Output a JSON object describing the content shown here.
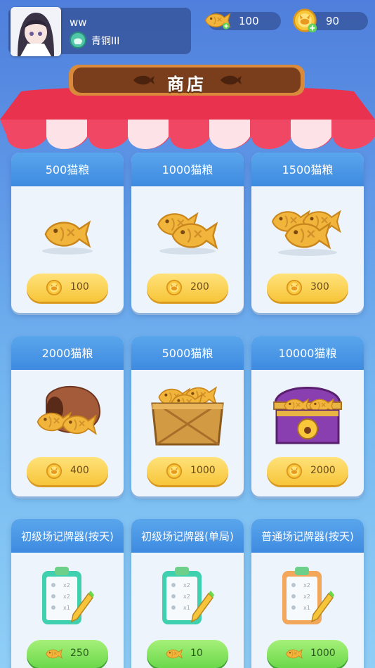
{
  "profile": {
    "name": "ww",
    "rank": "青铜III"
  },
  "currencies": [
    {
      "icon": "fish-food-icon",
      "value": "100"
    },
    {
      "icon": "cat-coin-icon",
      "value": "90"
    }
  ],
  "shop": {
    "title": "商店"
  },
  "items": [
    {
      "title": "500猫粮",
      "price": "100",
      "currency": "cat-coin-icon",
      "image": "single-fish-icon"
    },
    {
      "title": "1000猫粮",
      "price": "200",
      "currency": "cat-coin-icon",
      "image": "two-fish-icon"
    },
    {
      "title": "1500猫粮",
      "price": "300",
      "currency": "cat-coin-icon",
      "image": "three-fish-icon"
    },
    {
      "title": "2000猫粮",
      "price": "400",
      "currency": "cat-coin-icon",
      "image": "fish-bag-icon"
    },
    {
      "title": "5000猫粮",
      "price": "1000",
      "currency": "cat-coin-icon",
      "image": "fish-crate-icon"
    },
    {
      "title": "10000猫粮",
      "price": "2000",
      "currency": "cat-coin-icon",
      "image": "treasure-chest-icon"
    },
    {
      "title": "初级场记牌器(按天)",
      "price": "250",
      "currency": "fish-food-icon",
      "image": "green-clipboard-icon"
    },
    {
      "title": "初级场记牌器(单局)",
      "price": "10",
      "currency": "fish-food-icon",
      "image": "green-clipboard-icon"
    },
    {
      "title": "普通场记牌器(按天)",
      "price": "1000",
      "currency": "fish-food-icon",
      "image": "orange-clipboard-icon"
    }
  ],
  "colors": {
    "accent": "#3e8ae0",
    "price_gold": "#f7c53a",
    "price_green": "#6bd84a",
    "awning_red": "#e8324e"
  }
}
